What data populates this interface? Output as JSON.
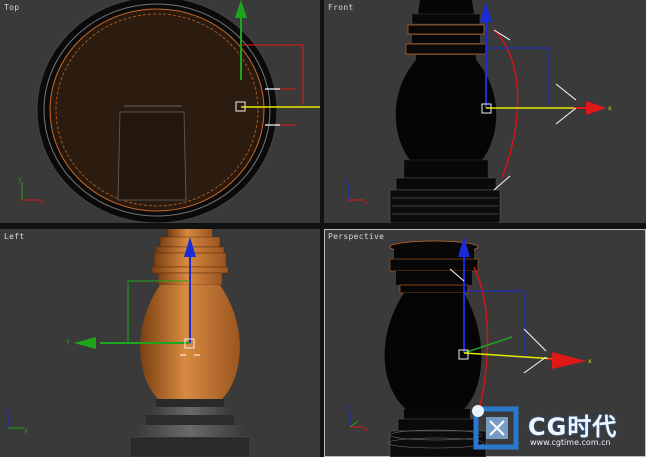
{
  "viewports": {
    "top": {
      "label": "Top"
    },
    "front": {
      "label": "Front"
    },
    "left": {
      "label": "Left"
    },
    "perspective": {
      "label": "Perspective"
    }
  },
  "axes": {
    "x": "x",
    "y": "y",
    "z": "z"
  },
  "watermark": {
    "brand": "CG时代",
    "url": "www.cgtime.com.cn"
  },
  "colors": {
    "viewport_bg": "#3a3a3a",
    "axis_x": "#e01818",
    "axis_y": "#1ea51e",
    "axis_z": "#1a2cd8",
    "object_orange": "#c97a35",
    "active_border": "#bdbdbd"
  }
}
